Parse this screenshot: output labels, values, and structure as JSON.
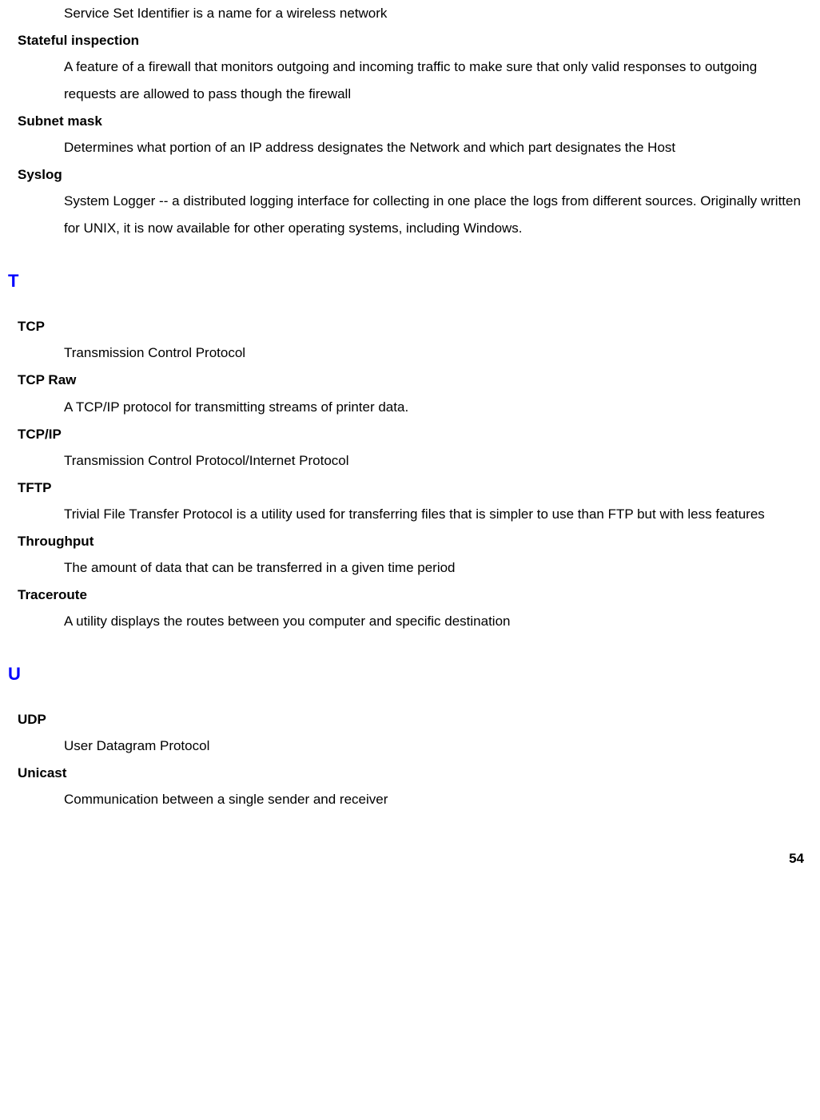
{
  "entries_top": [
    {
      "term": null,
      "def": "Service Set Identifier is a name for a wireless network"
    },
    {
      "term": "Stateful inspection",
      "def": "A feature of a firewall that monitors outgoing and incoming traffic to make sure that only valid responses to outgoing requests are allowed to pass though the firewall"
    },
    {
      "term": "Subnet mask",
      "def": "Determines what portion of an IP address designates the Network and which part designates the Host"
    },
    {
      "term": "Syslog",
      "def": "System Logger -- a distributed logging interface for collecting in one place the logs from different sources. Originally written for UNIX, it is now available for other operating systems, including Windows."
    }
  ],
  "section_T": {
    "letter": "T",
    "entries": [
      {
        "term": "TCP",
        "def": "Transmission Control Protocol"
      },
      {
        "term": "TCP Raw",
        "def": "A TCP/IP protocol for transmitting streams of printer data."
      },
      {
        "term": "TCP/IP",
        "def": "Transmission Control Protocol/Internet Protocol"
      },
      {
        "term": "TFTP",
        "def": "Trivial File Transfer Protocol is a utility used for transferring files that is simpler to use than FTP but with less features"
      },
      {
        "term": "Throughput",
        "def": "The amount of data that can be transferred in a given time period"
      },
      {
        "term": "Traceroute",
        "def": "A utility displays the routes between you computer and specific destination"
      }
    ]
  },
  "section_U": {
    "letter": "U",
    "entries": [
      {
        "term": "UDP",
        "def": "User Datagram Protocol"
      },
      {
        "term": "Unicast",
        "def": "Communication between a single sender and receiver"
      }
    ]
  },
  "page_number": "54"
}
